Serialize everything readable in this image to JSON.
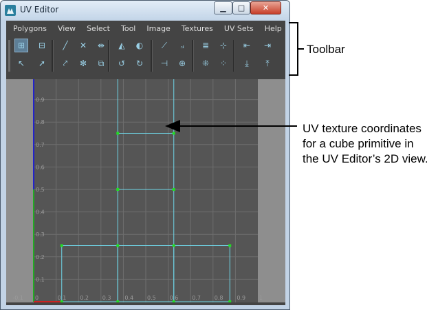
{
  "window": {
    "title": "UV Editor",
    "controls": {
      "minimize": "▁",
      "maximize": "□",
      "close": "✕"
    }
  },
  "menubar": [
    "Polygons",
    "View",
    "Select",
    "Tool",
    "Image",
    "Textures",
    "UV Sets",
    "Help"
  ],
  "toolbar": {
    "row1": [
      {
        "icon": "uv-lattice-icon",
        "glyph": "⊞",
        "active": true
      },
      {
        "icon": "uv-smudge-icon",
        "glyph": "⊟"
      },
      {
        "icon": "cut-uv-icon",
        "glyph": "╱"
      },
      {
        "icon": "delete-uv-icon",
        "glyph": "✕"
      },
      {
        "icon": "split-uv-icon",
        "glyph": "⇹"
      },
      {
        "icon": "flip-vertical-icon",
        "glyph": "◭"
      },
      {
        "icon": "flip-horizontal-icon",
        "glyph": "◐"
      },
      {
        "icon": "align-min-u-icon",
        "glyph": "⟋"
      },
      {
        "icon": "straighten-uv-icon",
        "glyph": "⟓"
      },
      {
        "icon": "layout-uv-icon",
        "glyph": "≣"
      },
      {
        "icon": "grid-uv-icon",
        "glyph": "⊹"
      },
      {
        "icon": "move-left-icon",
        "glyph": "⇤"
      },
      {
        "icon": "move-right-icon",
        "glyph": "⇥"
      }
    ],
    "row2": [
      {
        "icon": "select-uv-icon",
        "glyph": "↖"
      },
      {
        "icon": "select-shell-icon",
        "glyph": "➚"
      },
      {
        "icon": "smooth-uv-icon",
        "glyph": "⤤"
      },
      {
        "icon": "unfold-uv-icon",
        "glyph": "✻"
      },
      {
        "icon": "normalize-uv-icon",
        "glyph": "⧉"
      },
      {
        "icon": "rotate-ccw-icon",
        "glyph": "↺"
      },
      {
        "icon": "rotate-cw-icon",
        "glyph": "↻"
      },
      {
        "icon": "snap-u-icon",
        "glyph": "⊣"
      },
      {
        "icon": "snap-center-icon",
        "glyph": "⊕"
      },
      {
        "icon": "distribute-icon",
        "glyph": "⁜"
      },
      {
        "icon": "stack-shells-icon",
        "glyph": "⁘"
      },
      {
        "icon": "move-down-icon",
        "glyph": "⤓"
      },
      {
        "icon": "move-up-icon",
        "glyph": "⤒"
      }
    ]
  },
  "uv_view": {
    "v_labels": [
      "0.9",
      "0.8",
      "0.7",
      "0.6",
      "0.5",
      "0.4",
      "0.3",
      "0.2",
      "0.1"
    ],
    "u_labels": [
      "-0.1",
      "0",
      "0.1",
      "0.2",
      "0.3",
      "0.4",
      "0.5",
      "0.6",
      "0.7",
      "0.8",
      "0.9",
      "1"
    ],
    "colors": {
      "grid_bg": "#555555",
      "gridline": "#6e6e6e",
      "outside": "#8e8e8e",
      "uv_edge": "#6fd6e8",
      "uv_vertex": "#22dd22",
      "v_axis": "#2222cc",
      "v_axis_green": "#22aa22",
      "u_axis_red": "#cc2222"
    }
  },
  "annotations": {
    "toolbar_label": "Toolbar",
    "uv_label_line1": "UV texture coordinates",
    "uv_label_line2": "for a cube primitive in",
    "uv_label_line3": "the UV Editor’s 2D view."
  }
}
